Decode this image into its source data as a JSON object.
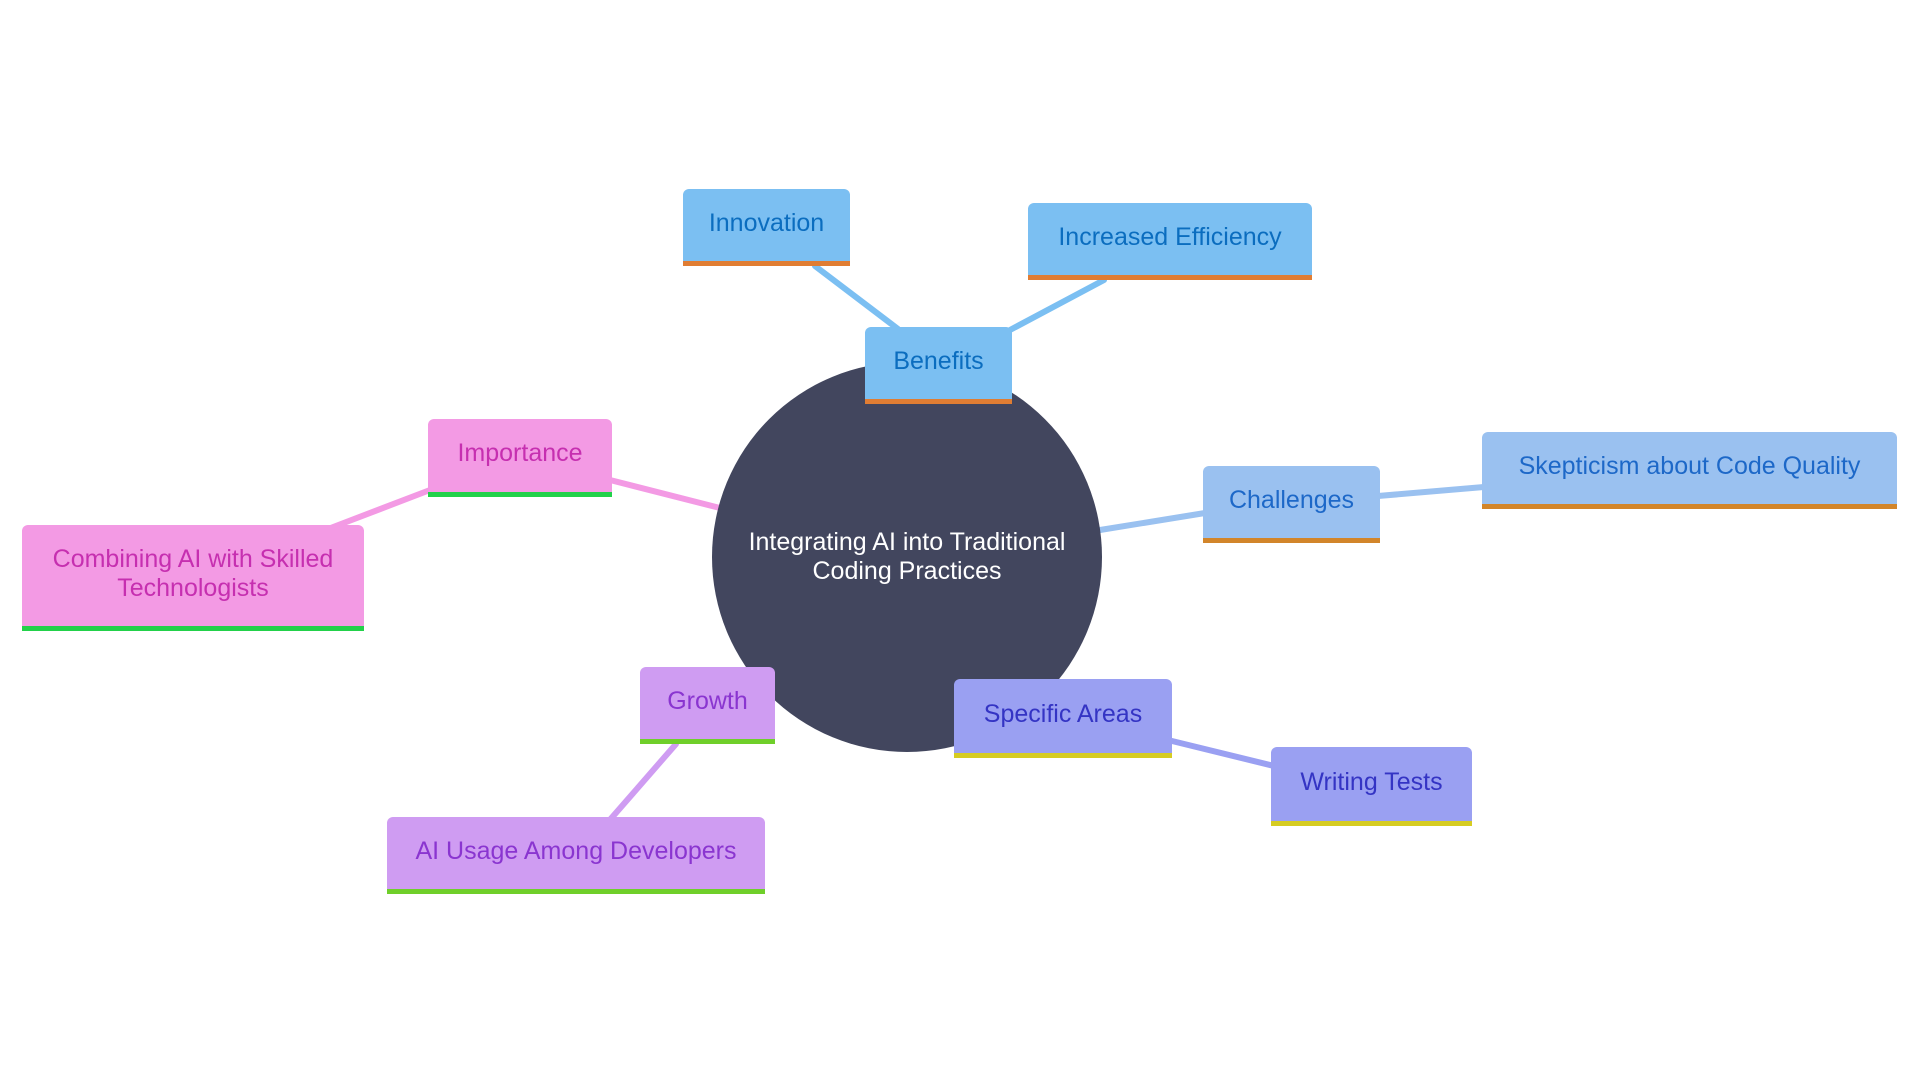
{
  "diagram": {
    "type": "mindmap",
    "root": {
      "id": "root",
      "label": "Integrating AI into Traditional Coding Practices",
      "color": "#42465e"
    },
    "branches": [
      {
        "id": "benefits",
        "label": "Benefits",
        "fill": "#7bbff2",
        "text": "#0b6dbf",
        "accent": "#e07d33",
        "children": [
          {
            "id": "innovation",
            "label": "Innovation"
          },
          {
            "id": "efficiency",
            "label": "Increased Efficiency"
          }
        ]
      },
      {
        "id": "challenges",
        "label": "Challenges",
        "fill": "#9ac1f0",
        "text": "#1d68c8",
        "accent": "#d2852a",
        "children": [
          {
            "id": "skepticism",
            "label": "Skepticism about Code Quality"
          }
        ]
      },
      {
        "id": "specific",
        "label": "Specific Areas",
        "fill": "#9aa0f2",
        "text": "#3434c4",
        "accent": "#d6cc22",
        "children": [
          {
            "id": "tests",
            "label": "Writing Tests"
          }
        ]
      },
      {
        "id": "growth",
        "label": "Growth",
        "fill": "#cf9cf2",
        "text": "#8a35d0",
        "accent": "#6fcf2a",
        "children": [
          {
            "id": "usage",
            "label": "AI Usage Among Developers"
          }
        ]
      },
      {
        "id": "importance",
        "label": "Importance",
        "fill": "#f39ae4",
        "text": "#c62fb0",
        "accent": "#22d14a",
        "children": [
          {
            "id": "combining",
            "label": "Combining AI with Skilled Technologists"
          }
        ]
      }
    ],
    "edge_colors": {
      "benefits": "#7bbff2",
      "challenges": "#9ac1f0",
      "specific": "#9aa0f2",
      "growth": "#cf9cf2",
      "importance": "#f39ae4"
    }
  }
}
